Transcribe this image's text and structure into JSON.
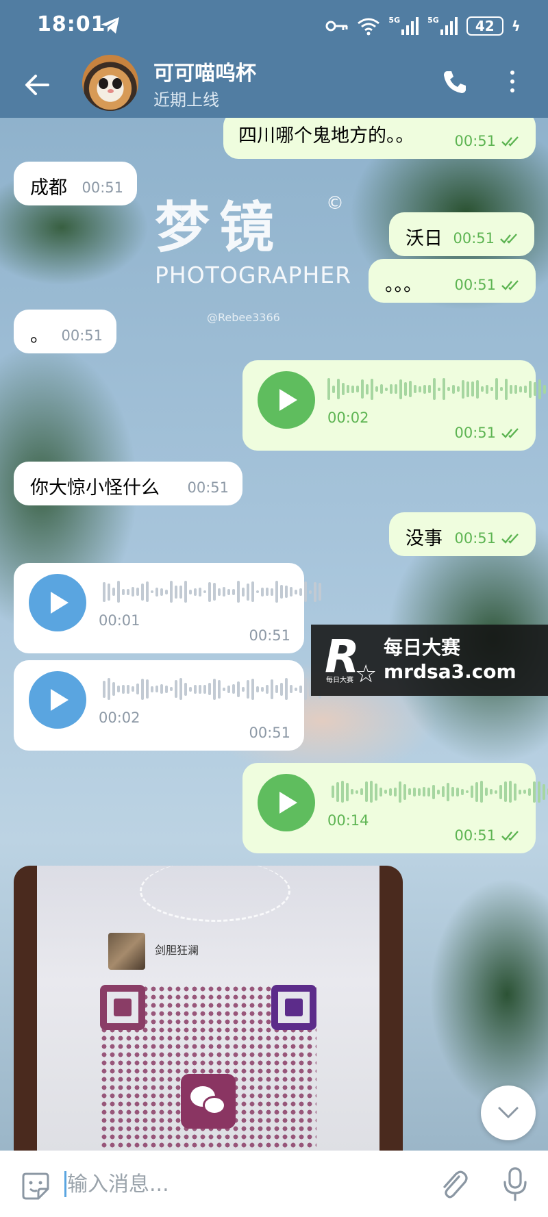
{
  "status_bar": {
    "time": "18:01",
    "signal1": "5G",
    "signal2": "5G",
    "battery": "42"
  },
  "header": {
    "title": "可可喵呜杯",
    "subtitle": "近期上线"
  },
  "watermark": {
    "text": "梦镜",
    "symbol": "©",
    "caption": "PHOTOGRAPHER",
    "handle": "@Rebee3366"
  },
  "messages": [
    {
      "dir": "out",
      "type": "text",
      "text": "四川哪个鬼地方的。。",
      "time": "00:51"
    },
    {
      "dir": "in",
      "type": "text",
      "text": "成都",
      "time": "00:51"
    },
    {
      "dir": "out",
      "type": "text",
      "text": "沃日",
      "time": "00:51"
    },
    {
      "dir": "out",
      "type": "text",
      "text": "。。。",
      "time": "00:51"
    },
    {
      "dir": "in",
      "type": "text",
      "text": "。",
      "time": "00:51"
    },
    {
      "dir": "out",
      "type": "voice",
      "duration": "00:02",
      "time": "00:51"
    },
    {
      "dir": "in",
      "type": "text",
      "text": "你大惊小怪什么",
      "time": "00:51"
    },
    {
      "dir": "out",
      "type": "text",
      "text": "没事",
      "time": "00:51"
    },
    {
      "dir": "in",
      "type": "voice",
      "duration": "00:01",
      "time": "00:51"
    },
    {
      "dir": "in",
      "type": "voice",
      "duration": "00:02",
      "time": "00:51"
    },
    {
      "dir": "out",
      "type": "voice",
      "duration": "00:14",
      "time": "00:51"
    },
    {
      "dir": "in",
      "type": "photo",
      "qr_name": "剑胆狂澜"
    }
  ],
  "ad_banner": {
    "title": "每日大赛",
    "url": "mrdsa3.com",
    "logo_letter": "R",
    "logo_caption": "每日大赛"
  },
  "input": {
    "placeholder": "输入消息..."
  },
  "colors": {
    "header": "#517da2",
    "bubble_out": "#effdde",
    "bubble_in": "#ffffff",
    "voice_in": "#5aa5e0",
    "voice_out": "#5fbd5e"
  },
  "icons": [
    "back-arrow-icon",
    "phone-icon",
    "more-vert-icon",
    "telegram-icon",
    "key-icon",
    "wifi-icon",
    "signal-icon",
    "battery-icon",
    "play-icon",
    "double-check-icon",
    "chevron-down-icon",
    "sticker-icon",
    "paperclip-icon",
    "microphone-icon"
  ]
}
